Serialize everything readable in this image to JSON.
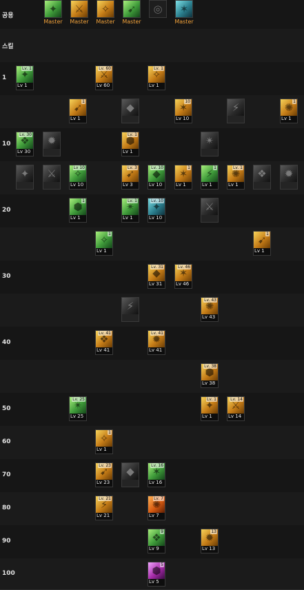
{
  "rows": [
    {
      "label": "공용",
      "h": 42
    },
    {
      "label": "스킬",
      "h": 48
    },
    {
      "label": "1",
      "h": 48
    },
    {
      "label": "",
      "h": 48
    },
    {
      "label": "10",
      "h": 48
    },
    {
      "label": "",
      "h": 48
    },
    {
      "label": "20",
      "h": 48
    },
    {
      "label": "",
      "h": 48
    },
    {
      "label": "30",
      "h": 48
    },
    {
      "label": "",
      "h": 48
    },
    {
      "label": "40",
      "h": 48
    },
    {
      "label": "",
      "h": 48
    },
    {
      "label": "50",
      "h": 48
    },
    {
      "label": "60",
      "h": 48
    },
    {
      "label": "70",
      "h": 48
    },
    {
      "label": "80",
      "h": 48
    },
    {
      "label": "90",
      "h": 48
    },
    {
      "label": "100",
      "h": 45
    }
  ],
  "common": [
    {
      "name": "common-skill-1",
      "color": "green",
      "icon": "dragon-icon",
      "label": "Master"
    },
    {
      "name": "common-skill-2",
      "color": "gold",
      "icon": "warrior-icon",
      "label": "Master"
    },
    {
      "name": "common-skill-3",
      "color": "gold",
      "icon": "runner-icon",
      "label": "Master"
    },
    {
      "name": "common-skill-4",
      "color": "green",
      "icon": "dash-icon",
      "label": "Master"
    },
    {
      "name": "common-skill-5",
      "color": "locked",
      "icon": "target-icon",
      "label": ""
    },
    {
      "name": "common-skill-6",
      "color": "teal",
      "icon": "eagle-icon",
      "label": "Master"
    }
  ],
  "skills": [
    {
      "row": 2,
      "col": 0,
      "color": "green",
      "icon": "fist-icon",
      "lv": "Lv 1",
      "rank": "Lv. 1"
    },
    {
      "row": 2,
      "col": 3,
      "color": "gold",
      "icon": "wave-icon",
      "lv": "Lv 60",
      "rank": "Lv. 60"
    },
    {
      "row": 2,
      "col": 5,
      "color": "gold",
      "icon": "slash-icon",
      "lv": "Lv 1",
      "rank": "Lv. 1"
    },
    {
      "row": 3,
      "col": 2,
      "color": "gold",
      "icon": "strike-icon",
      "lv": "Lv 1",
      "rank": "1"
    },
    {
      "row": 3,
      "col": 4,
      "color": "dark",
      "icon": "arrow-icon",
      "lv": "",
      "rank": ""
    },
    {
      "row": 3,
      "col": 6,
      "color": "gold",
      "icon": "spin-icon",
      "lv": "Lv 10",
      "rank": "10"
    },
    {
      "row": 3,
      "col": 8,
      "color": "dark",
      "icon": "shield-icon",
      "lv": "",
      "rank": ""
    },
    {
      "row": 3,
      "col": 10,
      "color": "gold",
      "icon": "wings-icon",
      "lv": "Lv 1",
      "rank": "1"
    },
    {
      "row": 4,
      "col": 0,
      "color": "green",
      "icon": "blade-icon",
      "lv": "Lv 30",
      "rank": "Lv. 30"
    },
    {
      "row": 4,
      "col": 1,
      "color": "dark",
      "icon": "sword-icon",
      "lv": "",
      "rank": ""
    },
    {
      "row": 4,
      "col": 4,
      "color": "gold",
      "icon": "flame-icon",
      "lv": "Lv 1",
      "rank": "Lv. 1"
    },
    {
      "row": 4,
      "col": 7,
      "color": "dark",
      "icon": "swirl-icon",
      "lv": "",
      "rank": ""
    },
    {
      "row": 5,
      "col": 0,
      "color": "dark",
      "icon": "block-icon",
      "lv": "",
      "rank": ""
    },
    {
      "row": 5,
      "col": 1,
      "color": "dark",
      "icon": "burst-icon",
      "lv": "",
      "rank": ""
    },
    {
      "row": 5,
      "col": 2,
      "color": "green",
      "icon": "thrust-icon",
      "lv": "Lv 10",
      "rank": "Lv 10"
    },
    {
      "row": 5,
      "col": 4,
      "color": "gold",
      "icon": "crescent-icon",
      "lv": "Lv 3",
      "rank": "Lv. 3"
    },
    {
      "row": 5,
      "col": 5,
      "color": "green",
      "icon": "moon-icon",
      "lv": "Lv 10",
      "rank": "Lv. 10"
    },
    {
      "row": 5,
      "col": 6,
      "color": "gold",
      "icon": "orb-icon",
      "lv": "Lv 1",
      "rank": "1"
    },
    {
      "row": 5,
      "col": 7,
      "color": "green",
      "icon": "ring-icon",
      "lv": "Lv 1",
      "rank": "1"
    },
    {
      "row": 5,
      "col": 8,
      "color": "gold",
      "icon": "claw-icon",
      "lv": "Lv 1",
      "rank": "Lv. 1"
    },
    {
      "row": 5,
      "col": 9,
      "color": "dark",
      "icon": "cross-icon",
      "lv": "",
      "rank": ""
    },
    {
      "row": 5,
      "col": 10,
      "color": "dark",
      "icon": "storm-icon",
      "lv": "",
      "rank": ""
    },
    {
      "row": 6,
      "col": 2,
      "color": "green",
      "icon": "figure-icon",
      "lv": "Lv 1",
      "rank": "1"
    },
    {
      "row": 6,
      "col": 4,
      "color": "green",
      "icon": "leaf-icon",
      "lv": "Lv 1",
      "rank": "Lv. 1"
    },
    {
      "row": 6,
      "col": 5,
      "color": "teal",
      "icon": "pillar-icon",
      "lv": "Lv 10",
      "rank": "Lv. 10"
    },
    {
      "row": 6,
      "col": 7,
      "color": "dark",
      "icon": "beast-icon",
      "lv": "",
      "rank": ""
    },
    {
      "row": 7,
      "col": 3,
      "color": "green",
      "icon": "wind-icon",
      "lv": "Lv 1",
      "rank": "1"
    },
    {
      "row": 7,
      "col": 9,
      "color": "gold",
      "icon": "rush-icon",
      "lv": "Lv 1",
      "rank": "1"
    },
    {
      "row": 8,
      "col": 5,
      "color": "gold",
      "icon": "lance-icon",
      "lv": "Lv 31",
      "rank": "Lv. 31"
    },
    {
      "row": 8,
      "col": 6,
      "color": "gold",
      "icon": "vortex-icon",
      "lv": "Lv 46",
      "rank": "Lv. 46"
    },
    {
      "row": 9,
      "col": 4,
      "color": "dark",
      "icon": "tower-icon",
      "lv": "",
      "rank": ""
    },
    {
      "row": 9,
      "col": 7,
      "color": "gold",
      "icon": "helix-icon",
      "lv": "Lv 43",
      "rank": "Lv. 43"
    },
    {
      "row": 10,
      "col": 3,
      "color": "gold",
      "icon": "gale-icon",
      "lv": "Lv 41",
      "rank": "Lv. 41"
    },
    {
      "row": 10,
      "col": 5,
      "color": "gold",
      "icon": "cleave-icon",
      "lv": "Lv 41",
      "rank": "Lv. 41"
    },
    {
      "row": 11,
      "col": 7,
      "color": "gold",
      "icon": "cyclone-icon",
      "lv": "Lv 38",
      "rank": "Lv. 38"
    },
    {
      "row": 12,
      "col": 2,
      "color": "green",
      "icon": "bird-icon",
      "lv": "Lv 25",
      "rank": "Lv. 25"
    },
    {
      "row": 12,
      "col": 7,
      "color": "gold",
      "icon": "pierce-icon",
      "lv": "Lv 1",
      "rank": "Lv. 1"
    },
    {
      "row": 12,
      "col": 8,
      "color": "gold",
      "icon": "chain-icon",
      "lv": "Lv 14",
      "rank": "Lv. 14"
    },
    {
      "row": 13,
      "col": 3,
      "color": "gold",
      "icon": "inferno-icon",
      "lv": "Lv 1",
      "rank": "1"
    },
    {
      "row": 14,
      "col": 3,
      "color": "gold",
      "icon": "fury-icon",
      "lv": "Lv 23",
      "rank": "Lv. 23"
    },
    {
      "row": 14,
      "col": 4,
      "color": "dark",
      "icon": "shadow-icon",
      "lv": "",
      "rank": ""
    },
    {
      "row": 14,
      "col": 5,
      "color": "green",
      "icon": "serpent-icon",
      "lv": "Lv 16",
      "rank": "Lv. 16"
    },
    {
      "row": 15,
      "col": 3,
      "color": "gold",
      "icon": "tempest-icon",
      "lv": "Lv 21",
      "rank": "Lv. 21"
    },
    {
      "row": 15,
      "col": 5,
      "color": "orange",
      "icon": "blaze-icon",
      "lv": "Lv 7",
      "rank": "Lv. 7"
    },
    {
      "row": 16,
      "col": 5,
      "color": "green",
      "icon": "wyvern-icon",
      "lv": "Lv 9",
      "rank": "9"
    },
    {
      "row": 16,
      "col": 7,
      "color": "gold",
      "icon": "star-icon",
      "lv": "Lv 13",
      "rank": "13"
    },
    {
      "row": 17,
      "col": 5,
      "color": "purple",
      "icon": "nova-icon",
      "lv": "Lv 5",
      "rank": "5"
    }
  ]
}
